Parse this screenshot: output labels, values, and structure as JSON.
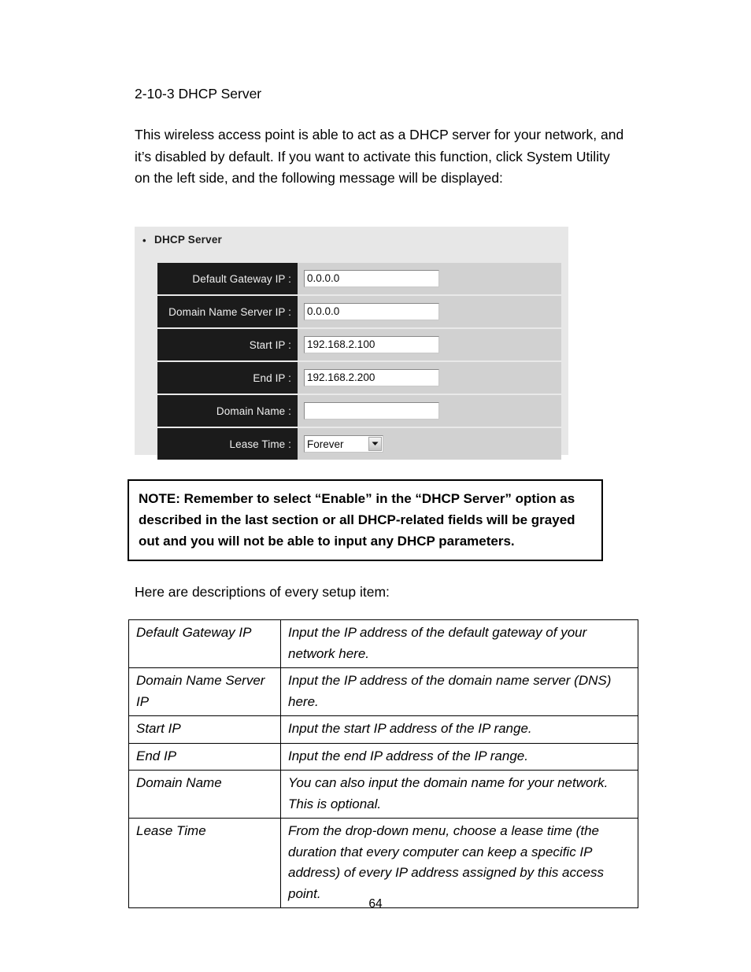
{
  "document": {
    "section_heading": "2-10-3 DHCP Server",
    "intro_paragraph": "This wireless access point is able to act as a DHCP server for your network, and it’s disabled by default. If you want to activate this function, click System Utility on the left side, and the following message will be displayed:",
    "note_text": "NOTE: Remember to select “Enable” in the “DHCP Server” option as described in the last section or all DHCP-related fields will be grayed out and you will not be able to input any DHCP parameters.",
    "descriptions_lead": "Here are descriptions of every setup item:",
    "page_number": "64"
  },
  "dhcp_panel": {
    "title": "DHCP Server",
    "bullet_glyph": "•",
    "fields": [
      {
        "label": "Default Gateway IP :",
        "type": "text",
        "value": "0.0.0.0",
        "placeholder": ""
      },
      {
        "label": "Domain Name Server IP :",
        "type": "text",
        "value": "0.0.0.0",
        "placeholder": ""
      },
      {
        "label": "Start IP :",
        "type": "text",
        "value": "192.168.2.100",
        "placeholder": ""
      },
      {
        "label": "End IP :",
        "type": "text",
        "value": "192.168.2.200",
        "placeholder": ""
      },
      {
        "label": "Domain Name :",
        "type": "text",
        "value": "",
        "placeholder": ""
      },
      {
        "label": "Lease Time :",
        "type": "select",
        "value": "Forever",
        "placeholder": ""
      }
    ],
    "colors": {
      "panel_background": "#e7e7e7",
      "row_background": "#d1d1d1",
      "label_background": "#1b1b1b",
      "label_text": "#efefef",
      "input_background": "#ffffff"
    }
  },
  "descriptions_table": {
    "rows": [
      {
        "term": "Default Gateway IP",
        "definition": "Input the IP address of the default gateway of your network here."
      },
      {
        "term": "Domain Name Server IP",
        "definition": "Input the IP address of the domain name server (DNS) here."
      },
      {
        "term": "Start IP",
        "definition": "Input the start IP address of the IP range."
      },
      {
        "term": "End IP",
        "definition": "Input the end IP address of the IP range."
      },
      {
        "term": "Domain Name",
        "definition": "You can also input the domain name for your network. This is optional."
      },
      {
        "term": "Lease Time",
        "definition": "From the drop-down menu, choose a lease time (the duration that every computer can keep a specific IP address) of every IP address assigned by this access point."
      }
    ]
  }
}
